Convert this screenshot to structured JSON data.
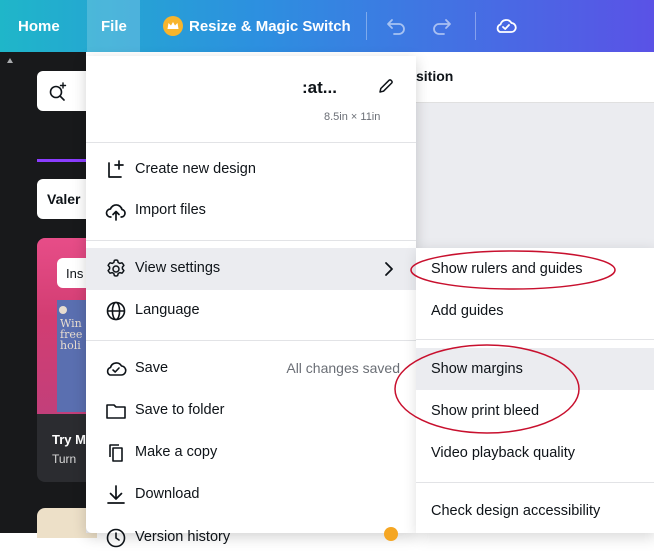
{
  "topbar": {
    "home_label": "Home",
    "file_label": "File",
    "resize_label": "Resize & Magic Switch",
    "icons": [
      "crown-icon",
      "undo-icon",
      "redo-icon",
      "cloud-check-icon"
    ]
  },
  "left_panel": {
    "dropdown_partial": "Valer",
    "insert_partial": "Ins",
    "thumb_lines": [
      "Win",
      "free",
      "holi"
    ],
    "promo_title_partial": "Try M",
    "promo_sub_partial": "Turn"
  },
  "canvas_header": {
    "partial_text": "sition"
  },
  "file_menu": {
    "title": ":at...",
    "size": "8.5in × 11in",
    "items": [
      {
        "label": "Create new design",
        "icon": "add-page-icon"
      },
      {
        "label": "Import files",
        "icon": "cloud-upload-icon"
      },
      {
        "label": "View settings",
        "icon": "gear-icon"
      },
      {
        "label": "Language",
        "icon": "globe-icon"
      },
      {
        "label": "Save",
        "icon": "cloud-check-icon",
        "aside": "All changes saved"
      },
      {
        "label": "Save to folder",
        "icon": "folder-icon"
      },
      {
        "label": "Make a copy",
        "icon": "copy-icon"
      },
      {
        "label": "Download",
        "icon": "download-icon"
      },
      {
        "label": "Version history",
        "icon": "clock-icon"
      }
    ]
  },
  "view_settings_submenu": {
    "items": [
      {
        "label": "Show rulers and guides"
      },
      {
        "label": "Add guides"
      },
      {
        "label": "Show margins"
      },
      {
        "label": "Show print bleed"
      },
      {
        "label": "Video playback quality"
      },
      {
        "label": "Check design accessibility"
      }
    ]
  },
  "colors": {
    "accent_purple": "#8b3dff",
    "annotation_red": "#c8102e",
    "menu_hover": "#ebecf0"
  }
}
